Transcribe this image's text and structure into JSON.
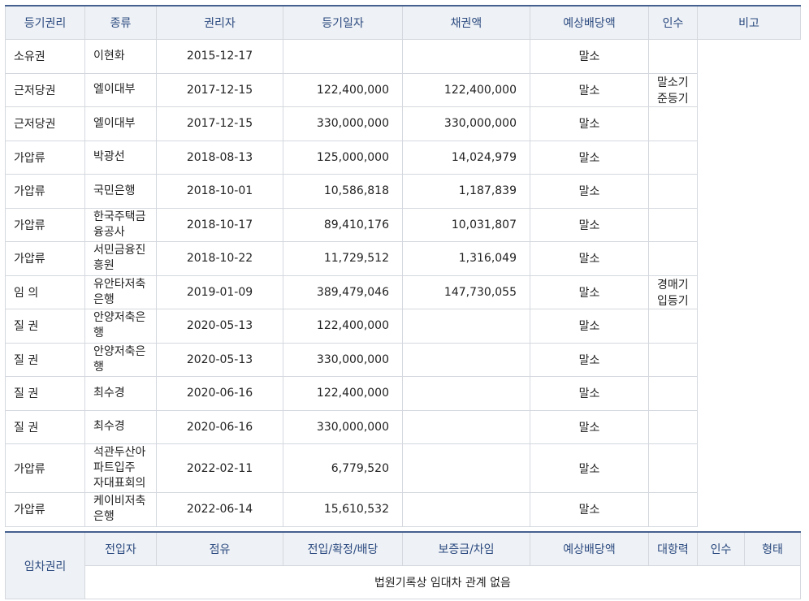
{
  "registered": {
    "section_label": "등기권리",
    "headers": [
      "종류",
      "권리자",
      "등기일자",
      "채권액",
      "예상배당액",
      "인수",
      "비고"
    ],
    "rows": [
      {
        "type": "소유권",
        "holder": "이현화",
        "date": "2015-12-17",
        "claim": "",
        "dividend": "",
        "takeover": "말소",
        "note": ""
      },
      {
        "type": "근저당권",
        "holder": "엘이대부",
        "date": "2017-12-15",
        "claim": "122,400,000",
        "dividend": "122,400,000",
        "takeover": "말소",
        "note": "말소기준등기"
      },
      {
        "type": "근저당권",
        "holder": "엘이대부",
        "date": "2017-12-15",
        "claim": "330,000,000",
        "dividend": "330,000,000",
        "takeover": "말소",
        "note": ""
      },
      {
        "type": "가압류",
        "holder": "박광선",
        "date": "2018-08-13",
        "claim": "125,000,000",
        "dividend": "14,024,979",
        "takeover": "말소",
        "note": ""
      },
      {
        "type": "가압류",
        "holder": "국민은행",
        "date": "2018-10-01",
        "claim": "10,586,818",
        "dividend": "1,187,839",
        "takeover": "말소",
        "note": ""
      },
      {
        "type": "가압류",
        "holder": "한국주택금융공사",
        "date": "2018-10-17",
        "claim": "89,410,176",
        "dividend": "10,031,807",
        "takeover": "말소",
        "note": ""
      },
      {
        "type": "가압류",
        "holder": "서민금융진흥원",
        "date": "2018-10-22",
        "claim": "11,729,512",
        "dividend": "1,316,049",
        "takeover": "말소",
        "note": ""
      },
      {
        "type": "임 의",
        "holder": "유안타저축은행",
        "date": "2019-01-09",
        "claim": "389,479,046",
        "dividend": "147,730,055",
        "takeover": "말소",
        "note": "경매기입등기"
      },
      {
        "type": "질 권",
        "holder": "안양저축은행",
        "date": "2020-05-13",
        "claim": "122,400,000",
        "dividend": "",
        "takeover": "말소",
        "note": ""
      },
      {
        "type": "질 권",
        "holder": "안양저축은행",
        "date": "2020-05-13",
        "claim": "330,000,000",
        "dividend": "",
        "takeover": "말소",
        "note": ""
      },
      {
        "type": "질 권",
        "holder": "최수경",
        "date": "2020-06-16",
        "claim": "122,400,000",
        "dividend": "",
        "takeover": "말소",
        "note": ""
      },
      {
        "type": "질 권",
        "holder": "최수경",
        "date": "2020-06-16",
        "claim": "330,000,000",
        "dividend": "",
        "takeover": "말소",
        "note": ""
      },
      {
        "type": "가압류",
        "holder": "석관두산아파트입주\n자대표회의",
        "date": "2022-02-11",
        "claim": "6,779,520",
        "dividend": "",
        "takeover": "말소",
        "note": ""
      },
      {
        "type": "가압류",
        "holder": "케이비저축은행",
        "date": "2022-06-14",
        "claim": "15,610,532",
        "dividend": "",
        "takeover": "말소",
        "note": ""
      }
    ]
  },
  "tenancy": {
    "section_label": "임차권리",
    "headers": [
      "전입자",
      "점유",
      "전입/확정/배당",
      "보증금/차임",
      "예상배당액",
      "대항력",
      "인수",
      "형태"
    ],
    "empty_message": "법원기록상 임대차 관계 없음"
  }
}
